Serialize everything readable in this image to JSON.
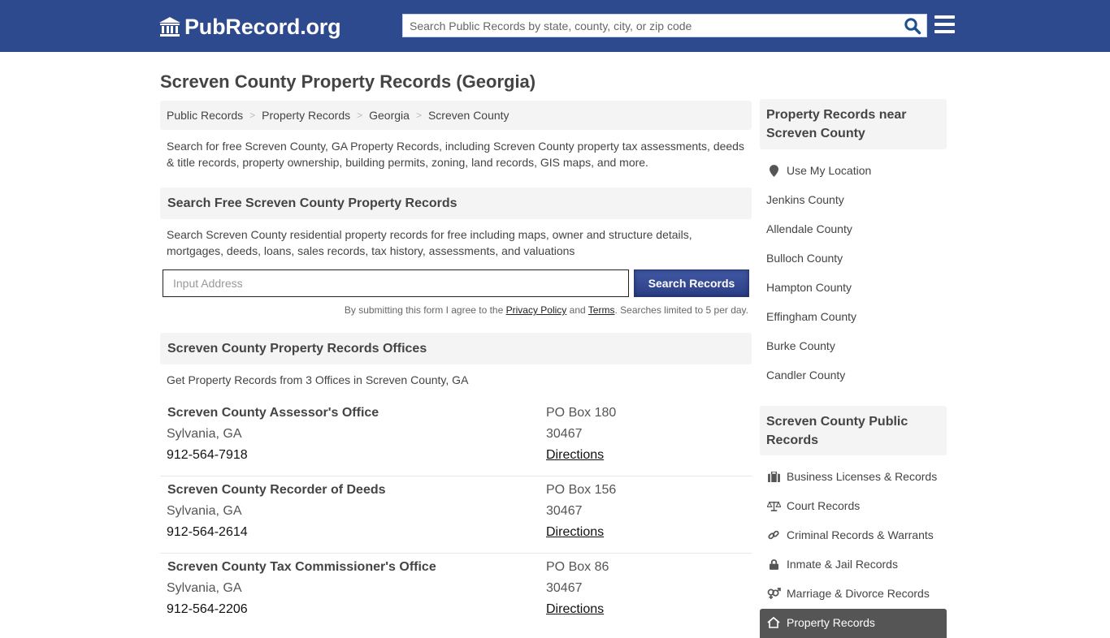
{
  "header": {
    "logo_text": "PubRecord.org",
    "search_placeholder": "Search Public Records by state, county, city, or zip code",
    "brand_color": "#2e4a8e"
  },
  "page": {
    "title": "Screven County Property Records (Georgia)",
    "breadcrumb": [
      "Public Records",
      "Property Records",
      "Georgia",
      "Screven County"
    ],
    "intro": "Search for free Screven County, GA Property Records, including Screven County property tax assessments, deeds & title records, property ownership, building permits, zoning, land records, GIS maps, and more."
  },
  "search_section": {
    "heading": "Search Free Screven County Property Records",
    "description": "Search Screven County residential property records for free including maps, owner and structure details, mortgages, deeds, loans, sales records, tax history, assessments, and valuations",
    "address_placeholder": "Input Address",
    "button_label": "Search Records",
    "disclaimer_prefix": "By submitting this form I agree to the ",
    "privacy_link": "Privacy Policy",
    "disclaimer_and": " and ",
    "terms_link": "Terms",
    "disclaimer_suffix": ". Searches limited to 5 per day."
  },
  "offices_section": {
    "heading": "Screven County Property Records Offices",
    "count_text": "Get Property Records from 3 Offices in Screven County, GA",
    "offices": [
      {
        "name": "Screven County Assessor's Office",
        "city": "Sylvania, GA",
        "phone": "912-564-7918",
        "pobox": "PO Box 180",
        "zip": "30467",
        "directions": "Directions"
      },
      {
        "name": "Screven County Recorder of Deeds",
        "city": "Sylvania, GA",
        "phone": "912-564-2614",
        "pobox": "PO Box 156",
        "zip": "30467",
        "directions": "Directions"
      },
      {
        "name": "Screven County Tax Commissioner's Office",
        "city": "Sylvania, GA",
        "phone": "912-564-2206",
        "pobox": "PO Box 86",
        "zip": "30467",
        "directions": "Directions"
      }
    ]
  },
  "sidebar": {
    "nearby_heading": "Property Records near Screven County",
    "use_location": "Use My Location",
    "nearby_counties": [
      "Jenkins County",
      "Allendale County",
      "Bulloch County",
      "Hampton County",
      "Effingham County",
      "Burke County",
      "Candler County"
    ],
    "public_heading": "Screven County Public Records",
    "public_records": [
      {
        "label": "Business Licenses & Records",
        "icon": "briefcase-icon"
      },
      {
        "label": "Court Records",
        "icon": "scales-icon"
      },
      {
        "label": "Criminal Records & Warrants",
        "icon": "link-icon"
      },
      {
        "label": "Inmate & Jail Records",
        "icon": "lock-icon"
      },
      {
        "label": "Marriage & Divorce Records",
        "icon": "gender-icon"
      },
      {
        "label": "Property Records",
        "icon": "home-icon",
        "active": true
      }
    ]
  }
}
